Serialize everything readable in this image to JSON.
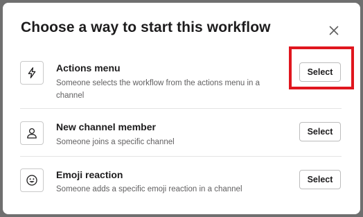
{
  "dialog": {
    "title": "Choose a way to start this workflow",
    "close_icon": "close-icon"
  },
  "options": [
    {
      "title": "Actions menu",
      "description": "Someone selects the workflow from the actions menu in a channel",
      "icon": "lightning-bolt-icon",
      "button_label": "Select",
      "highlighted": true
    },
    {
      "title": "New channel member",
      "description": "Someone joins a specific channel",
      "icon": "person-icon",
      "button_label": "Select",
      "highlighted": false
    },
    {
      "title": "Emoji reaction",
      "description": "Someone adds a specific emoji reaction in a channel",
      "icon": "smiley-face-icon",
      "button_label": "Select",
      "highlighted": false
    }
  ],
  "colors": {
    "highlight_border": "#e0161e",
    "text_primary": "#1d1c1d",
    "text_secondary": "#616061"
  }
}
